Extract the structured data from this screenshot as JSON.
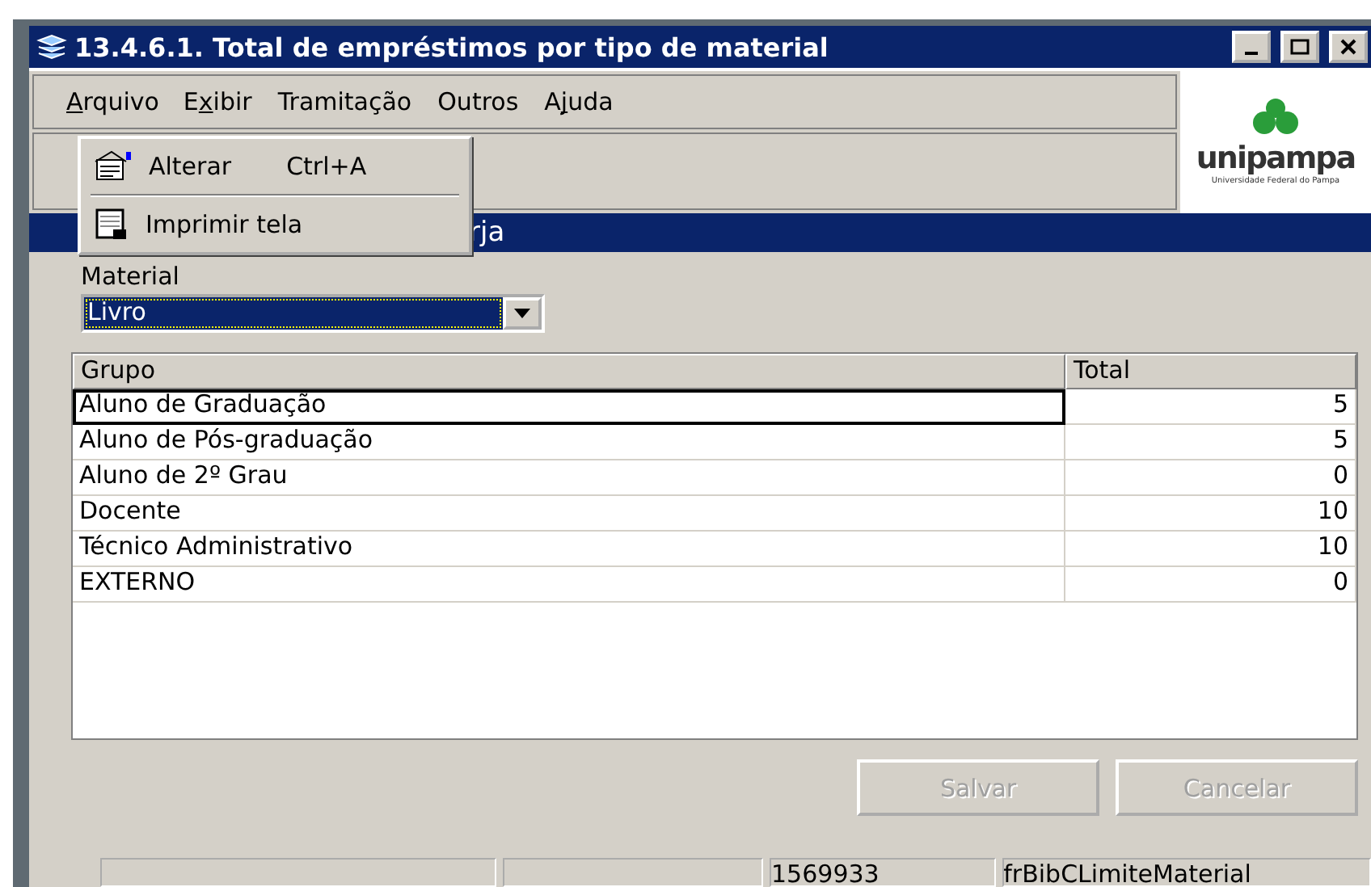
{
  "window": {
    "title": "13.4.6.1. Total de empréstimos por tipo de material"
  },
  "menu": [
    {
      "open": true,
      "label": [
        {
          "text": "A",
          "underlined": true
        },
        {
          "text": "rquivo",
          "underlined": false
        }
      ]
    },
    {
      "open": false,
      "label": [
        {
          "text": "E",
          "underlined": false
        },
        {
          "text": "x",
          "underlined": true
        },
        {
          "text": "ibir",
          "underlined": false
        }
      ]
    },
    {
      "open": false,
      "label": [
        {
          "text": "Tramitação",
          "underlined": false
        }
      ]
    },
    {
      "open": false,
      "label": [
        {
          "text": "Outros",
          "underlined": false
        }
      ]
    },
    {
      "open": false,
      "label": [
        {
          "text": "A",
          "underlined": false
        },
        {
          "text": "j",
          "underlined": true
        },
        {
          "text": "uda",
          "underlined": false
        }
      ]
    }
  ],
  "dropdown": [
    {
      "kind": "item",
      "label": "Alterar",
      "shortcut": "Ctrl+A"
    },
    {
      "kind": "separator"
    },
    {
      "kind": "item",
      "label": "Imprimir tela"
    }
  ],
  "logo": {
    "name": "unipampa",
    "tagline": "Universidade Federal do Pampa"
  },
  "band": {
    "text": "rja"
  },
  "material": {
    "label": "Material",
    "value": "Livro"
  },
  "table": {
    "columns": [
      "Grupo",
      "Total"
    ],
    "rows": [
      {
        "grupo": "Aluno de Graduação",
        "total": "5",
        "selected": true
      },
      {
        "grupo": "Aluno de Pós-graduação",
        "total": "5",
        "selected": false
      },
      {
        "grupo": "Aluno de 2º Grau",
        "total": "0",
        "selected": false
      },
      {
        "grupo": "Docente",
        "total": "10",
        "selected": false
      },
      {
        "grupo": "Técnico Administrativo",
        "total": "10",
        "selected": false
      },
      {
        "grupo": "EXTERNO",
        "total": "0",
        "selected": false
      }
    ]
  },
  "buttons": [
    {
      "label": "Salvar",
      "disabled": true
    },
    {
      "label": "Cancelar",
      "disabled": true
    }
  ],
  "status_bar": [
    "1569933",
    "frBibCLimiteMaterial"
  ]
}
